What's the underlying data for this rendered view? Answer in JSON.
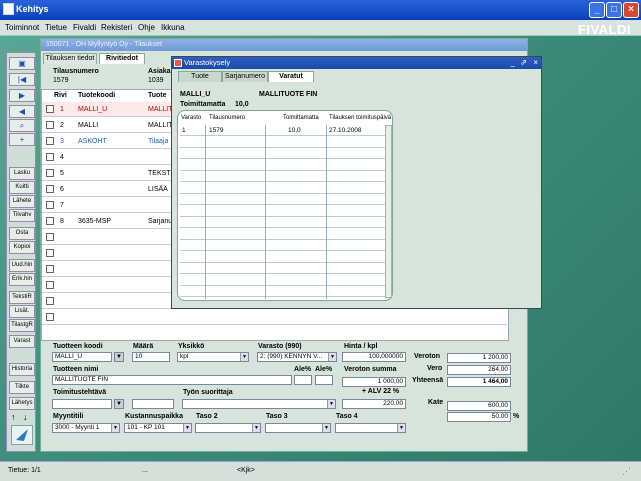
{
  "window": {
    "title": "Kehitys"
  },
  "menu": {
    "items": [
      "Toiminnot",
      "Tietue",
      "Fivaldi",
      "Rekisteri",
      "Ohje",
      "Ikkuna"
    ]
  },
  "logo": "FIVALDI",
  "main_window": {
    "caption": "150071 - OH Myllyntyö Oy - Tilaukset",
    "tabs": [
      "Tilauksen tiedot",
      "Rivitiedot"
    ],
    "header": {
      "order_no_label": "Tilausnumero",
      "order_no_value": "1579",
      "customer_label": "Asiaka",
      "customer_value": "1039"
    },
    "grid_headers": [
      "Rivi",
      "Tuotekoodi",
      "Tuote"
    ],
    "rows": [
      {
        "num": "1",
        "code": "MALLI_U",
        "name": "MALLIT",
        "color": "#c00000"
      },
      {
        "num": "2",
        "code": "MALLI",
        "name": "MALLIT",
        "color": "#000000"
      },
      {
        "num": "3",
        "code": "ASKOHT",
        "name": "Tilaaja",
        "color": "#1a5fc0"
      },
      {
        "num": "4",
        "code": "",
        "name": "",
        "color": "#000000"
      },
      {
        "num": "5",
        "code": "",
        "name": "TEKSTI",
        "color": "#000000"
      },
      {
        "num": "6",
        "code": "",
        "name": "LISÄÄ",
        "color": "#000000"
      },
      {
        "num": "7",
        "code": "",
        "name": "",
        "color": "#000000"
      },
      {
        "num": "8",
        "code": "3635-MSP",
        "name": "Sarjanu",
        "color": "#000000"
      }
    ],
    "form": {
      "product_code_label": "Tuotteen koodi",
      "product_code": "MALLI_U",
      "qty_label": "Määrä",
      "qty": "10",
      "unit_label": "Yksikkö",
      "unit": "kpl",
      "warehouse_label": "Varasto (990)",
      "warehouse": "2: (990) KENNYN V...",
      "price_label": "Hinta / kpl",
      "price": "100,000000",
      "product_name_label": "Tuotteen nimi",
      "product_name": "MALLITUOTE FIN",
      "disc1_label": "Ale%",
      "disc2_label": "Ale%",
      "net_total_label": "Veroton summa",
      "net_total": "1 000,00",
      "vat_label": "+ ALV  22 %",
      "vat_total": "220,00",
      "delivery_label": "Toimitustehtävä",
      "work_label": "Työn suorittaja",
      "seller_label": "Myyntitili",
      "seller": "3000 - Myynti 1",
      "costcenter_label": "Kustannuspaikka",
      "costcenter": "101 - KP 101",
      "level2_label": "Taso 2",
      "level3_label": "Taso 3",
      "level4_label": "Taso 4"
    },
    "totals": {
      "net_label": "Veroton",
      "net": "1 200,00",
      "vat_label": "Vero",
      "vat": "264,00",
      "total_label": "Yhteensä",
      "total": "1 464,00",
      "margin_label": "Kate",
      "margin": "600,00",
      "margin_pct": "50,00",
      "pct_sign": "%"
    }
  },
  "left_toolbar": [
    "Lasku",
    "Kuitti",
    "Lähete",
    "Tilvahv",
    "Osta",
    "Kopioi",
    "Uud.hin",
    "Erik.hin",
    "TekstiR",
    "Lisät.",
    "TilastgR",
    "Varast",
    "Historia",
    "Tilkte",
    "Lähetys"
  ],
  "popup": {
    "caption": "Varastokysely",
    "tabs": [
      "Tuote",
      "Sarjanumero",
      "Varatut"
    ],
    "product_code": "MALLI_U",
    "product_name": "MALLITUOTE FIN",
    "undelivered_label": "Toimittamatta",
    "undelivered_value": "10,0",
    "grid_headers": [
      "Varasto",
      "Tilausnumero",
      "Toimittamatta",
      "Tilauksen toimituspäivä"
    ],
    "grid_rows": [
      {
        "warehouse": "1",
        "order": "1579",
        "qty": "10,0",
        "date": "27.10.2008"
      }
    ]
  },
  "status": {
    "record": "Tietue: 1/1",
    "dots": "...",
    "mode": "<Kjk>"
  }
}
